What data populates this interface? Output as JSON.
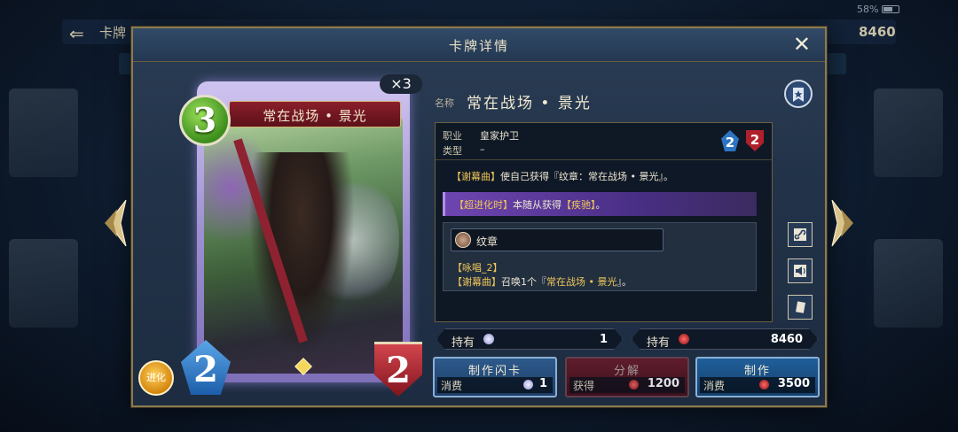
{
  "background": {
    "back_label": "卡牌",
    "battery": "58%",
    "currency": "8460"
  },
  "dialog": {
    "title": "卡牌详情",
    "close_symbol": "✕"
  },
  "card": {
    "name": "常在战场 • 景光",
    "cost": "3",
    "attack": "2",
    "defense": "2",
    "copies": "×3",
    "evolve_label": "进化"
  },
  "details": {
    "name_label": "名称",
    "name_value": "常在战场 • 景光",
    "class_label": "职业",
    "class_value": "皇家护卫",
    "type_label": "类型",
    "type_value": "–",
    "mini_attack": "2",
    "mini_defense": "2",
    "effect_prefix": "【谢幕曲】",
    "effect_body": "使自己获得『纹章：常在战场 • 景光』。",
    "super_evo_prefix": "【超进化时】",
    "super_evo_body": "本随从获得",
    "super_evo_keyword": "【疾驰】",
    "super_evo_end": "。",
    "emblem_label": "纹章",
    "emblem_line1": "【咏唱_2】",
    "emblem_line2_prefix": "【谢幕曲】",
    "emblem_line2_body": "召唤1个『",
    "emblem_line2_keyword": "常在战场 • 景光",
    "emblem_line2_end": "』。"
  },
  "ownership": {
    "owned_label": "持有",
    "owned_flash_count": "1",
    "owned_label_2": "持有",
    "owned_vials": "8460"
  },
  "actions": {
    "craft_flash_label": "制作闪卡",
    "craft_flash_cost_label": "消费",
    "craft_flash_cost": "1",
    "dismantle_label": "分解",
    "dismantle_gain_label": "获得",
    "dismantle_gain": "1200",
    "craft_label": "制作",
    "craft_cost_label": "消费",
    "craft_cost": "3500"
  },
  "icons": {
    "favorite": "bookmark-star-icon",
    "link": "link-icon",
    "voice": "speaker-icon",
    "card_detail": "card-icon",
    "vial": "red-vial-icon",
    "flash_ticket": "flash-ticket-icon"
  },
  "colors": {
    "gold_accent": "#f0c65a",
    "cost_green": "#3d8e1d",
    "attack_blue": "#2e74c4",
    "defense_red": "#b0202a",
    "super_evo_purple": "#6e45b0"
  }
}
